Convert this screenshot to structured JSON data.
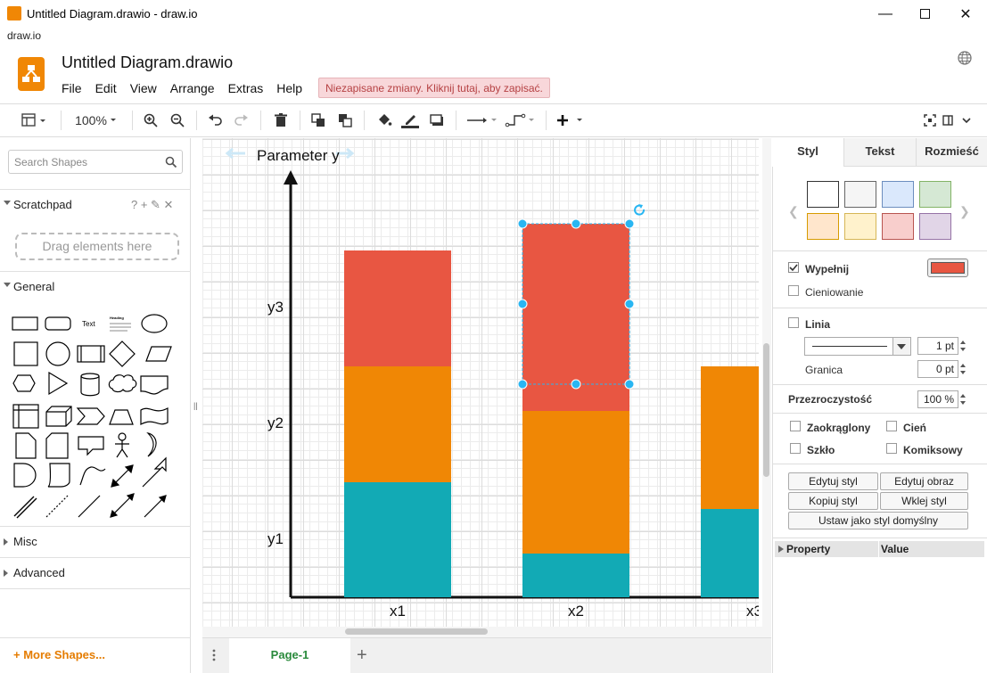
{
  "window": {
    "title": "Untitled Diagram.drawio - draw.io",
    "app_name": "draw.io"
  },
  "header": {
    "doc_title": "Untitled Diagram.drawio",
    "menu": [
      "File",
      "Edit",
      "View",
      "Arrange",
      "Extras",
      "Help"
    ],
    "unsaved_notice": "Niezapisane zmiany. Kliknij tutaj, aby zapisać."
  },
  "toolbar": {
    "zoom": "100%"
  },
  "sidebar": {
    "search_placeholder": "Search Shapes",
    "scratchpad": "Scratchpad",
    "scratchpad_icons": "? + ✎ ✕",
    "dropzone": "Drag elements here",
    "general": "General",
    "misc": "Misc",
    "advanced": "Advanced",
    "more_shapes": "+ More Shapes...",
    "shape_text": "Text",
    "shape_heading": "Heading"
  },
  "diagram": {
    "y_title": "Parameter y",
    "y_labels": [
      "y3",
      "y2",
      "y1"
    ],
    "x_labels": [
      "x1",
      "x2",
      "x3"
    ],
    "colors": {
      "top": "#e85642",
      "middle": "#f08705",
      "bottom": "#12aab5"
    }
  },
  "pages": {
    "tab": "Page-1"
  },
  "format_panel": {
    "tabs": [
      "Styl",
      "Tekst",
      "Rozmieść"
    ],
    "swatches": [
      "#ffffff",
      "#f5f5f5",
      "#dae8fc",
      "#d5e8d4",
      "#ffe6cc",
      "#fff2cc",
      "#f8cecc",
      "#e1d5e7"
    ],
    "fill_label": "Wypełnij",
    "fill_color": "#e85642",
    "shadow_label": "Cieniowanie",
    "line_label": "Linia",
    "line_width": "1 pt",
    "border_label": "Granica",
    "border_value": "0 pt",
    "opacity_label": "Przezroczystość",
    "opacity_value": "100 %",
    "rounded": "Zaokrąglony",
    "shadow2": "Cień",
    "glass": "Szkło",
    "comic": "Komiksowy",
    "buttons": [
      "Edytuj styl",
      "Edytuj obraz",
      "Kopiuj styl",
      "Wklej styl"
    ],
    "default_style": "Ustaw jako styl domyślny",
    "property_header": "Property",
    "value_header": "Value"
  }
}
